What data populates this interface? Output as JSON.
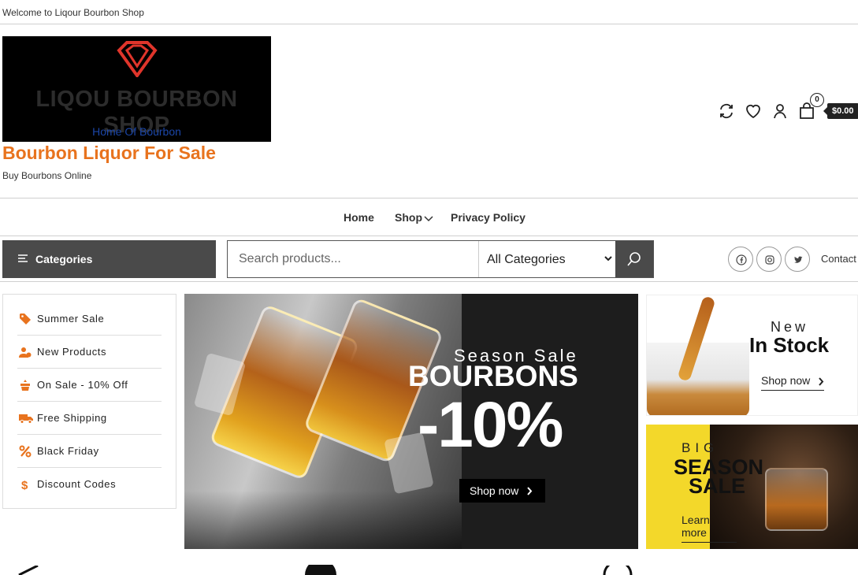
{
  "topbar": {
    "welcome": "Welcome to Liqour Bourbon Shop"
  },
  "logo": {
    "brand": "LIQOU BOURBON SHOP",
    "tagline": "Home Of Bourbon"
  },
  "site": {
    "title": "Bourbon Liquor For Sale",
    "description": "Buy Bourbons Online"
  },
  "header_icons": {
    "icons": [
      "compare-icon",
      "heart-icon",
      "user-icon",
      "shopping-bag-icon"
    ],
    "cart_count": "0",
    "cart_total": "$0.00"
  },
  "nav": {
    "items": [
      {
        "label": "Home"
      },
      {
        "label": "Shop"
      },
      {
        "label": "Privacy Policy"
      }
    ]
  },
  "toolbar": {
    "categories_label": "Categories",
    "search_placeholder": "Search products...",
    "category_select": "All Categories",
    "contact": "Contact"
  },
  "social": {
    "icons": [
      "facebook-icon",
      "instagram-icon",
      "twitter-icon"
    ]
  },
  "sidebar": {
    "items": [
      {
        "label": "Summer Sale",
        "icon": "tag-icon"
      },
      {
        "label": "New Products",
        "icon": "users-icon"
      },
      {
        "label": "On Sale - 10% Off",
        "icon": "crown-icon"
      },
      {
        "label": "Free Shipping",
        "icon": "truck-icon"
      },
      {
        "label": "Black Friday",
        "icon": "percent-icon"
      },
      {
        "label": "Discount Codes",
        "icon": "dollar-icon"
      }
    ]
  },
  "hero": {
    "season": "Season Sale",
    "headline": "BOURBONS",
    "discount": "-10%",
    "button": "Shop now"
  },
  "promo1": {
    "kicker": "New",
    "headline": "In Stock",
    "link": "Shop now"
  },
  "promo2": {
    "kicker": "BIG",
    "headline_line1": "SEASON",
    "headline_line2": "SALE",
    "link": "Learn more"
  },
  "colors": {
    "accent_orange": "#e8731e",
    "dark": "#4a4a4a",
    "promo_yellow": "#f3d82a",
    "logo_red": "#e0352b"
  }
}
